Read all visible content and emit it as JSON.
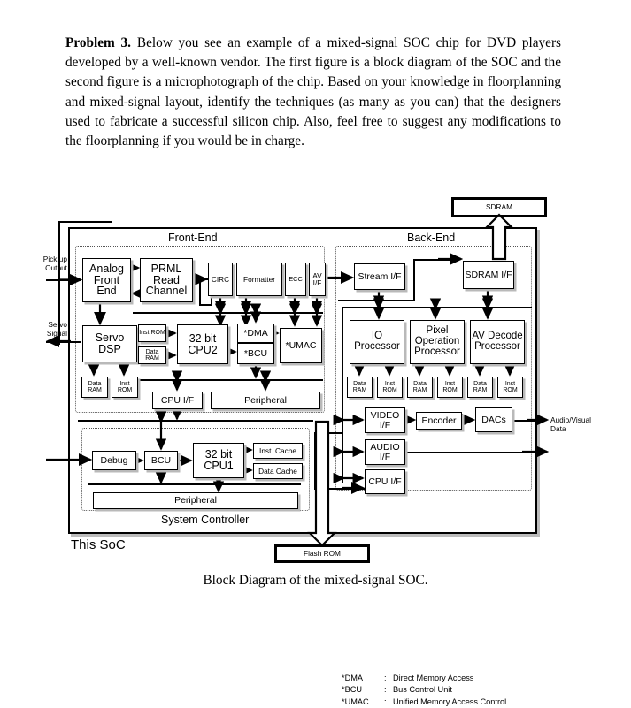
{
  "problem": {
    "label": "Problem 3.",
    "body": "Below you see an example of a mixed-signal SOC chip for DVD players developed by a well-known vendor. The first figure is a block diagram of the SOC and the second figure is a microphotograph of the chip. Based on your knowledge in floorplanning and mixed-signal layout, identify the techniques (as many as you can) that the designers used to fabricate a successful silicon chip. Also, feel free to suggest any modifications to the floorplanning if you would be in charge."
  },
  "caption": "Block Diagram of the mixed-signal SOC.",
  "diagram": {
    "external": {
      "sdram": "SDRAM",
      "flash_rom": "Flash ROM"
    },
    "regions": {
      "front_end": "Front-End",
      "back_end": "Back-End",
      "system_controller": "System Controller",
      "this_soc": "This SoC"
    },
    "io_labels": {
      "pickup_output": "Pick up\nOutput",
      "servo_signal": "Servo\nSignal",
      "audio_visual_data": "Audio/Visual\nData"
    },
    "front_end_blocks": {
      "analog_front_end": "Analog\nFront\nEnd",
      "prml_read_channel": "PRML\nRead\nChannel",
      "circ": "CIRC",
      "formatter": "Formatter",
      "ecc": "ECC",
      "av_if": "AV\nI/F",
      "servo_dsp": "Servo\nDSP",
      "inst_rom_1": "Inst\nROM",
      "data_ram_1": "Data\nRAM",
      "cpu2": "32 bit\nCPU2",
      "dma": "*DMA",
      "bcu": "*BCU",
      "umac": "*UMAC",
      "data_ram_2": "Data\nRAM",
      "inst_rom_2": "Inst\nROM",
      "cpu_if": "CPU I/F",
      "peripheral": "Peripheral"
    },
    "back_end_blocks": {
      "stream_if": "Stream\nI/F",
      "sdram_if": "SDRAM\nI/F",
      "io_processor": "IO\nProcessor",
      "pixel_operation_processor": "Pixel\nOperation\nProcessor",
      "av_decode_processor": "AV\nDecode\nProcessor",
      "data_ram_io": "Data\nRAM",
      "inst_rom_io": "Inst\nROM",
      "data_ram_pixel": "Data\nRAM",
      "inst_rom_pixel": "Inst\nROM",
      "data_ram_av": "Data\nRAM",
      "inst_rom_av": "Inst\nROM",
      "video_if": "VIDEO\nI/F",
      "encoder": "Encoder",
      "dacs": "DACs",
      "audio_if": "AUDIO\nI/F",
      "cpu_if": "CPU\nI/F"
    },
    "system_controller_blocks": {
      "debug": "Debug",
      "bcu": "BCU",
      "cpu1": "32 bit\nCPU1",
      "inst_cache": "Inst. Cache",
      "data_cache": "Data Cache",
      "peripheral": "Peripheral"
    },
    "legend": [
      {
        "key": "*DMA",
        "colon": ":",
        "value": "Direct Memory Access"
      },
      {
        "key": "*BCU",
        "colon": ":",
        "value": "Bus Control Unit"
      },
      {
        "key": "*UMAC",
        "colon": ":",
        "value": "Unified Memory Access Control"
      }
    ]
  }
}
